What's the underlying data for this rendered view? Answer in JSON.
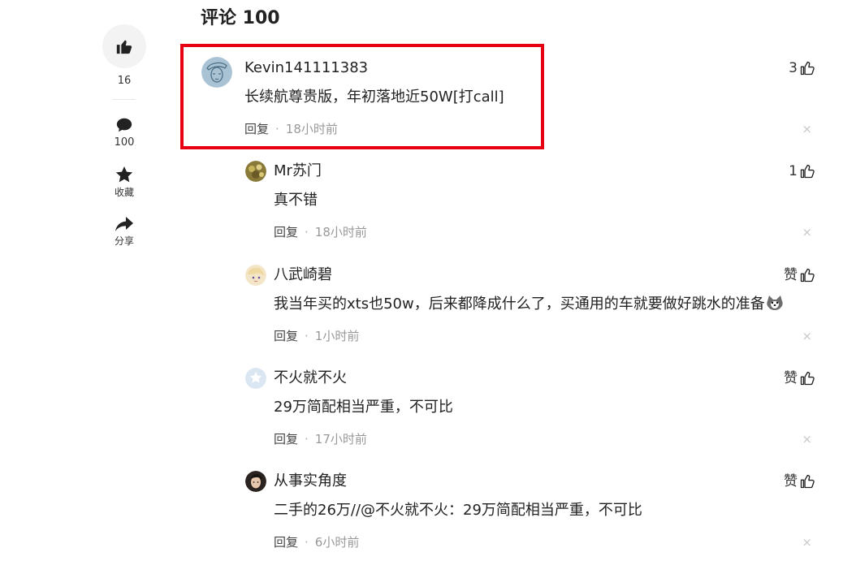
{
  "sidebar": {
    "like_count": "16",
    "comment_count": "100",
    "collect_label": "收藏",
    "share_label": "分享"
  },
  "section": {
    "title": "评论 100"
  },
  "comments": [
    {
      "user": "Kevin141111383",
      "text": "长续航尊贵版，年初落地近50W[打call]",
      "reply_label": "回复",
      "time": "18小时前",
      "likes": "3"
    },
    {
      "user": "Mr苏门",
      "text": "真不错",
      "reply_label": "回复",
      "time": "18小时前",
      "likes": "1"
    },
    {
      "user": "八武崎碧",
      "text": "我当年买的xts也50w，后来都降成什么了，买通用的车就要做好跳水的准备",
      "reply_label": "回复",
      "time": "1小时前",
      "likes": "赞"
    },
    {
      "user": "不火就不火",
      "text": "29万简配相当严重，不可比",
      "reply_label": "回复",
      "time": "17小时前",
      "likes": "赞"
    },
    {
      "user": "从事实角度",
      "text": "二手的26万//@不火就不火：29万简配相当严重，不可比",
      "reply_label": "回复",
      "time": "6小时前",
      "likes": "赞"
    }
  ],
  "close_glyph": "×",
  "separator_dot": "·",
  "colors": {
    "highlight": "#e60012",
    "meta_gray": "#999999",
    "sidebar_circle": "#f3f3f3"
  }
}
